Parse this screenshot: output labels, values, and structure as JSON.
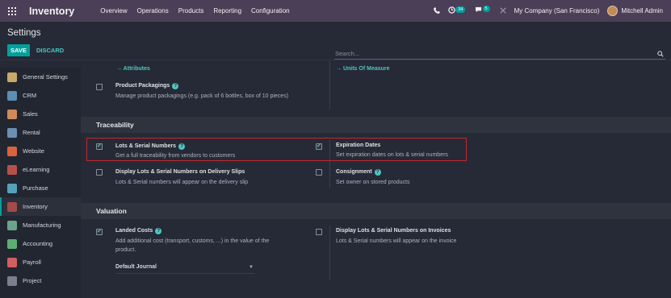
{
  "navbar": {
    "app_name": "Inventory",
    "menu": [
      "Overview",
      "Operations",
      "Products",
      "Reporting",
      "Configuration"
    ],
    "activity_count": "34",
    "message_count": "5",
    "company": "My Company (San Francisco)",
    "user": "Mitchell Admin"
  },
  "control": {
    "title": "Settings",
    "save_label": "SAVE",
    "discard_label": "DISCARD",
    "search_placeholder": "Search..."
  },
  "sidebar": {
    "items": [
      {
        "label": "General Settings",
        "color": "#c8a96a",
        "icon": "gear-icon"
      },
      {
        "label": "CRM",
        "color": "#5b8fb3",
        "icon": "handshake-icon"
      },
      {
        "label": "Sales",
        "color": "#d08b57",
        "icon": "chart-icon"
      },
      {
        "label": "Rental",
        "color": "#6c8fb4",
        "icon": "calendar-icon"
      },
      {
        "label": "Website",
        "color": "#d8643f",
        "icon": "globe-icon"
      },
      {
        "label": "eLearning",
        "color": "#b8504a",
        "icon": "book-icon"
      },
      {
        "label": "Purchase",
        "color": "#52a3b8",
        "icon": "cart-icon"
      },
      {
        "label": "Inventory",
        "color": "#a44b4b",
        "icon": "boxes-icon"
      },
      {
        "label": "Manufacturing",
        "color": "#6aa58a",
        "icon": "wrench-icon"
      },
      {
        "label": "Accounting",
        "color": "#5cae73",
        "icon": "calculator-icon"
      },
      {
        "label": "Payroll",
        "color": "#d06060",
        "icon": "money-icon"
      },
      {
        "label": "Project",
        "color": "#7b7f8e",
        "icon": "puzzle-icon"
      }
    ]
  },
  "main": {
    "links": {
      "attributes": "→ Attributes",
      "units": "→ Units Of Measure"
    },
    "product_packagings": {
      "title": "Product Packagings",
      "desc": "Manage product packagings (e.g. pack of 6 bottles, box of 10 pieces)"
    },
    "traceability_header": "Traceability",
    "lots_serial": {
      "title": "Lots & Serial Numbers",
      "desc": "Get a full traceability from vendors to customers"
    },
    "expiration": {
      "title": "Expiration Dates",
      "desc": "Set expiration dates on lots & serial numbers"
    },
    "lots_delivery": {
      "title": "Display Lots & Serial Numbers on Delivery Slips",
      "desc": "Lots & Serial numbers will appear on the delivery slip"
    },
    "consignment": {
      "title": "Consignment",
      "desc": "Set owner on stored products"
    },
    "valuation_header": "Valuation",
    "landed_costs": {
      "title": "Landed Costs",
      "desc1": "Add additional cost (transport, customs, ...) in the value of the",
      "desc2": "product."
    },
    "default_journal": "Default Journal",
    "lots_invoices": {
      "title": "Display Lots & Serial Numbers on Invoices",
      "desc": "Lots & Serial numbers will appear on the invoice"
    }
  },
  "colors": {
    "navbar": "#4b3f58",
    "accent": "#00a09d",
    "highlight": "#c0282b"
  }
}
